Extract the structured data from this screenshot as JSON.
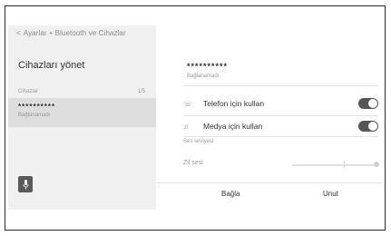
{
  "breadcrumb": {
    "back_glyph": "<",
    "root": "Ayarlar",
    "sep": "•",
    "current": "Bluetooth ve Cihazlar"
  },
  "left": {
    "title": "Cihazları yönet",
    "section": "Cihazlar",
    "count": "1/5",
    "device": {
      "name": "**********",
      "status": "Bağlanamadı"
    },
    "mic_icon": "microphone-icon"
  },
  "right": {
    "device": {
      "name": "**********",
      "status": "Bağlanamadı"
    },
    "options": [
      {
        "icon": "phone-icon",
        "glyph": "☏",
        "label": "Telefon için kullan",
        "enabled": true
      },
      {
        "icon": "music-note-icon",
        "glyph": "♫",
        "label": "Medya için kullan",
        "enabled": true
      }
    ],
    "volume_section": "Ses seviyesi",
    "ringtone_label": "Zil sesi",
    "buttons": {
      "connect": "Bağla",
      "forget": "Unut"
    }
  }
}
